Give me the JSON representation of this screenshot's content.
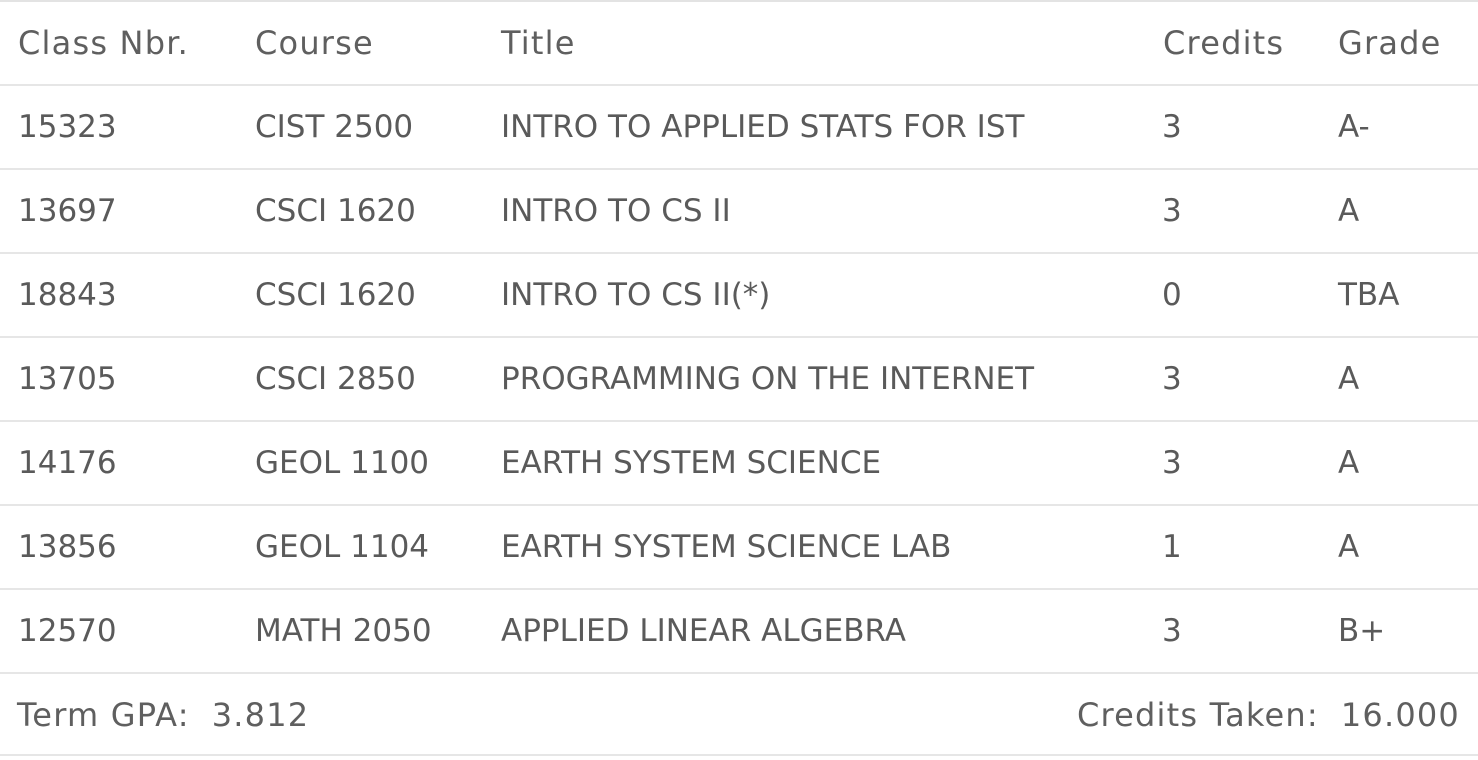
{
  "table": {
    "headers": {
      "class_nbr": "Class Nbr.",
      "course": "Course",
      "title": "Title",
      "credits": "Credits",
      "grade": "Grade"
    },
    "rows": [
      {
        "class_nbr": "15323",
        "course": "CIST 2500",
        "title": "INTRO TO APPLIED STATS FOR IST",
        "credits": "3",
        "grade": "A-"
      },
      {
        "class_nbr": "13697",
        "course": "CSCI 1620",
        "title": "INTRO TO CS II",
        "credits": "3",
        "grade": "A"
      },
      {
        "class_nbr": "18843",
        "course": "CSCI 1620",
        "title": "INTRO TO CS II(*)",
        "credits": "0",
        "grade": "TBA"
      },
      {
        "class_nbr": "13705",
        "course": "CSCI 2850",
        "title": "PROGRAMMING ON THE INTERNET",
        "credits": "3",
        "grade": "A"
      },
      {
        "class_nbr": "14176",
        "course": "GEOL 1100",
        "title": "EARTH SYSTEM SCIENCE",
        "credits": "3",
        "grade": "A"
      },
      {
        "class_nbr": "13856",
        "course": "GEOL 1104",
        "title": "EARTH SYSTEM SCIENCE LAB",
        "credits": "1",
        "grade": "A"
      },
      {
        "class_nbr": "12570",
        "course": "MATH 2050",
        "title": "APPLIED LINEAR ALGEBRA",
        "credits": "3",
        "grade": "B+"
      }
    ]
  },
  "summary": {
    "term_gpa_label": "Term GPA:",
    "term_gpa_value": "3.812",
    "credits_taken_label": "Credits Taken:",
    "credits_taken_value": "16.000"
  }
}
